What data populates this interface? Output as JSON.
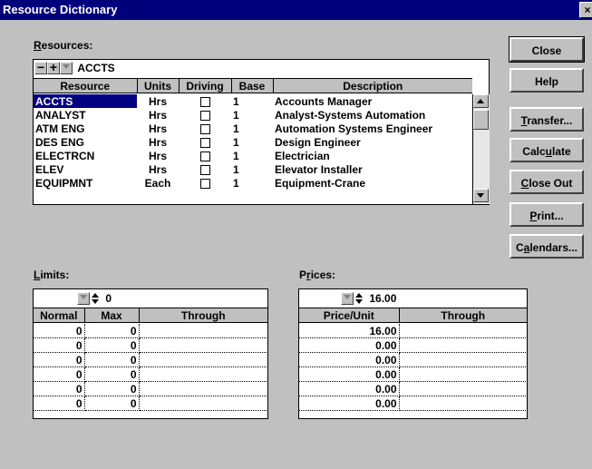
{
  "window": {
    "title": "Resource Dictionary",
    "close_glyph": "×"
  },
  "resources": {
    "label_underline": "R",
    "label_rest": "esources:",
    "toolbar": {
      "minus": "−",
      "plus": "+",
      "current": "ACCTS"
    },
    "columns": [
      "Resource",
      "Units",
      "Driving",
      "Base",
      "Description"
    ],
    "rows": [
      {
        "resource": "ACCTS",
        "units": "Hrs",
        "base": "1",
        "description": "Accounts Manager"
      },
      {
        "resource": "ANALYST",
        "units": "Hrs",
        "base": "1",
        "description": "Analyst-Systems Automation"
      },
      {
        "resource": "ATM ENG",
        "units": "Hrs",
        "base": "1",
        "description": "Automation Systems Engineer"
      },
      {
        "resource": "DES ENG",
        "units": "Hrs",
        "base": "1",
        "description": "Design Engineer"
      },
      {
        "resource": "ELECTRCN",
        "units": "Hrs",
        "base": "1",
        "description": "Electrician"
      },
      {
        "resource": "ELEV",
        "units": "Hrs",
        "base": "1",
        "description": "Elevator Installer"
      },
      {
        "resource": "EQUIPMNT",
        "units": "Each",
        "base": "1",
        "description": "Equipment-Crane"
      }
    ]
  },
  "buttons": {
    "close": "Close",
    "help": "Help",
    "transfer_u": "T",
    "transfer_rest": "ransfer...",
    "calculate_pre": "Calc",
    "calculate_u": "u",
    "calculate_rest": "late",
    "closeout_u": "C",
    "closeout_rest": "lose Out",
    "print_u": "P",
    "print_rest": "rint...",
    "calendars_pre": "C",
    "calendars_u": "a",
    "calendars_rest": "lendars..."
  },
  "limits": {
    "label_underline": "L",
    "label_rest": "imits:",
    "value": "0",
    "columns": [
      "Normal",
      "Max",
      "Through"
    ],
    "rows": [
      {
        "normal": "0",
        "max": "0",
        "through": ""
      },
      {
        "normal": "0",
        "max": "0",
        "through": ""
      },
      {
        "normal": "0",
        "max": "0",
        "through": ""
      },
      {
        "normal": "0",
        "max": "0",
        "through": ""
      },
      {
        "normal": "0",
        "max": "0",
        "through": ""
      },
      {
        "normal": "0",
        "max": "0",
        "through": ""
      }
    ]
  },
  "prices": {
    "label_pre": "P",
    "label_underline": "r",
    "label_rest": "ices:",
    "value": "16.00",
    "columns": [
      "Price/Unit",
      "Through"
    ],
    "rows": [
      {
        "price": "16.00",
        "through": ""
      },
      {
        "price": "0.00",
        "through": ""
      },
      {
        "price": "0.00",
        "through": ""
      },
      {
        "price": "0.00",
        "through": ""
      },
      {
        "price": "0.00",
        "through": ""
      },
      {
        "price": "0.00",
        "through": ""
      }
    ]
  }
}
